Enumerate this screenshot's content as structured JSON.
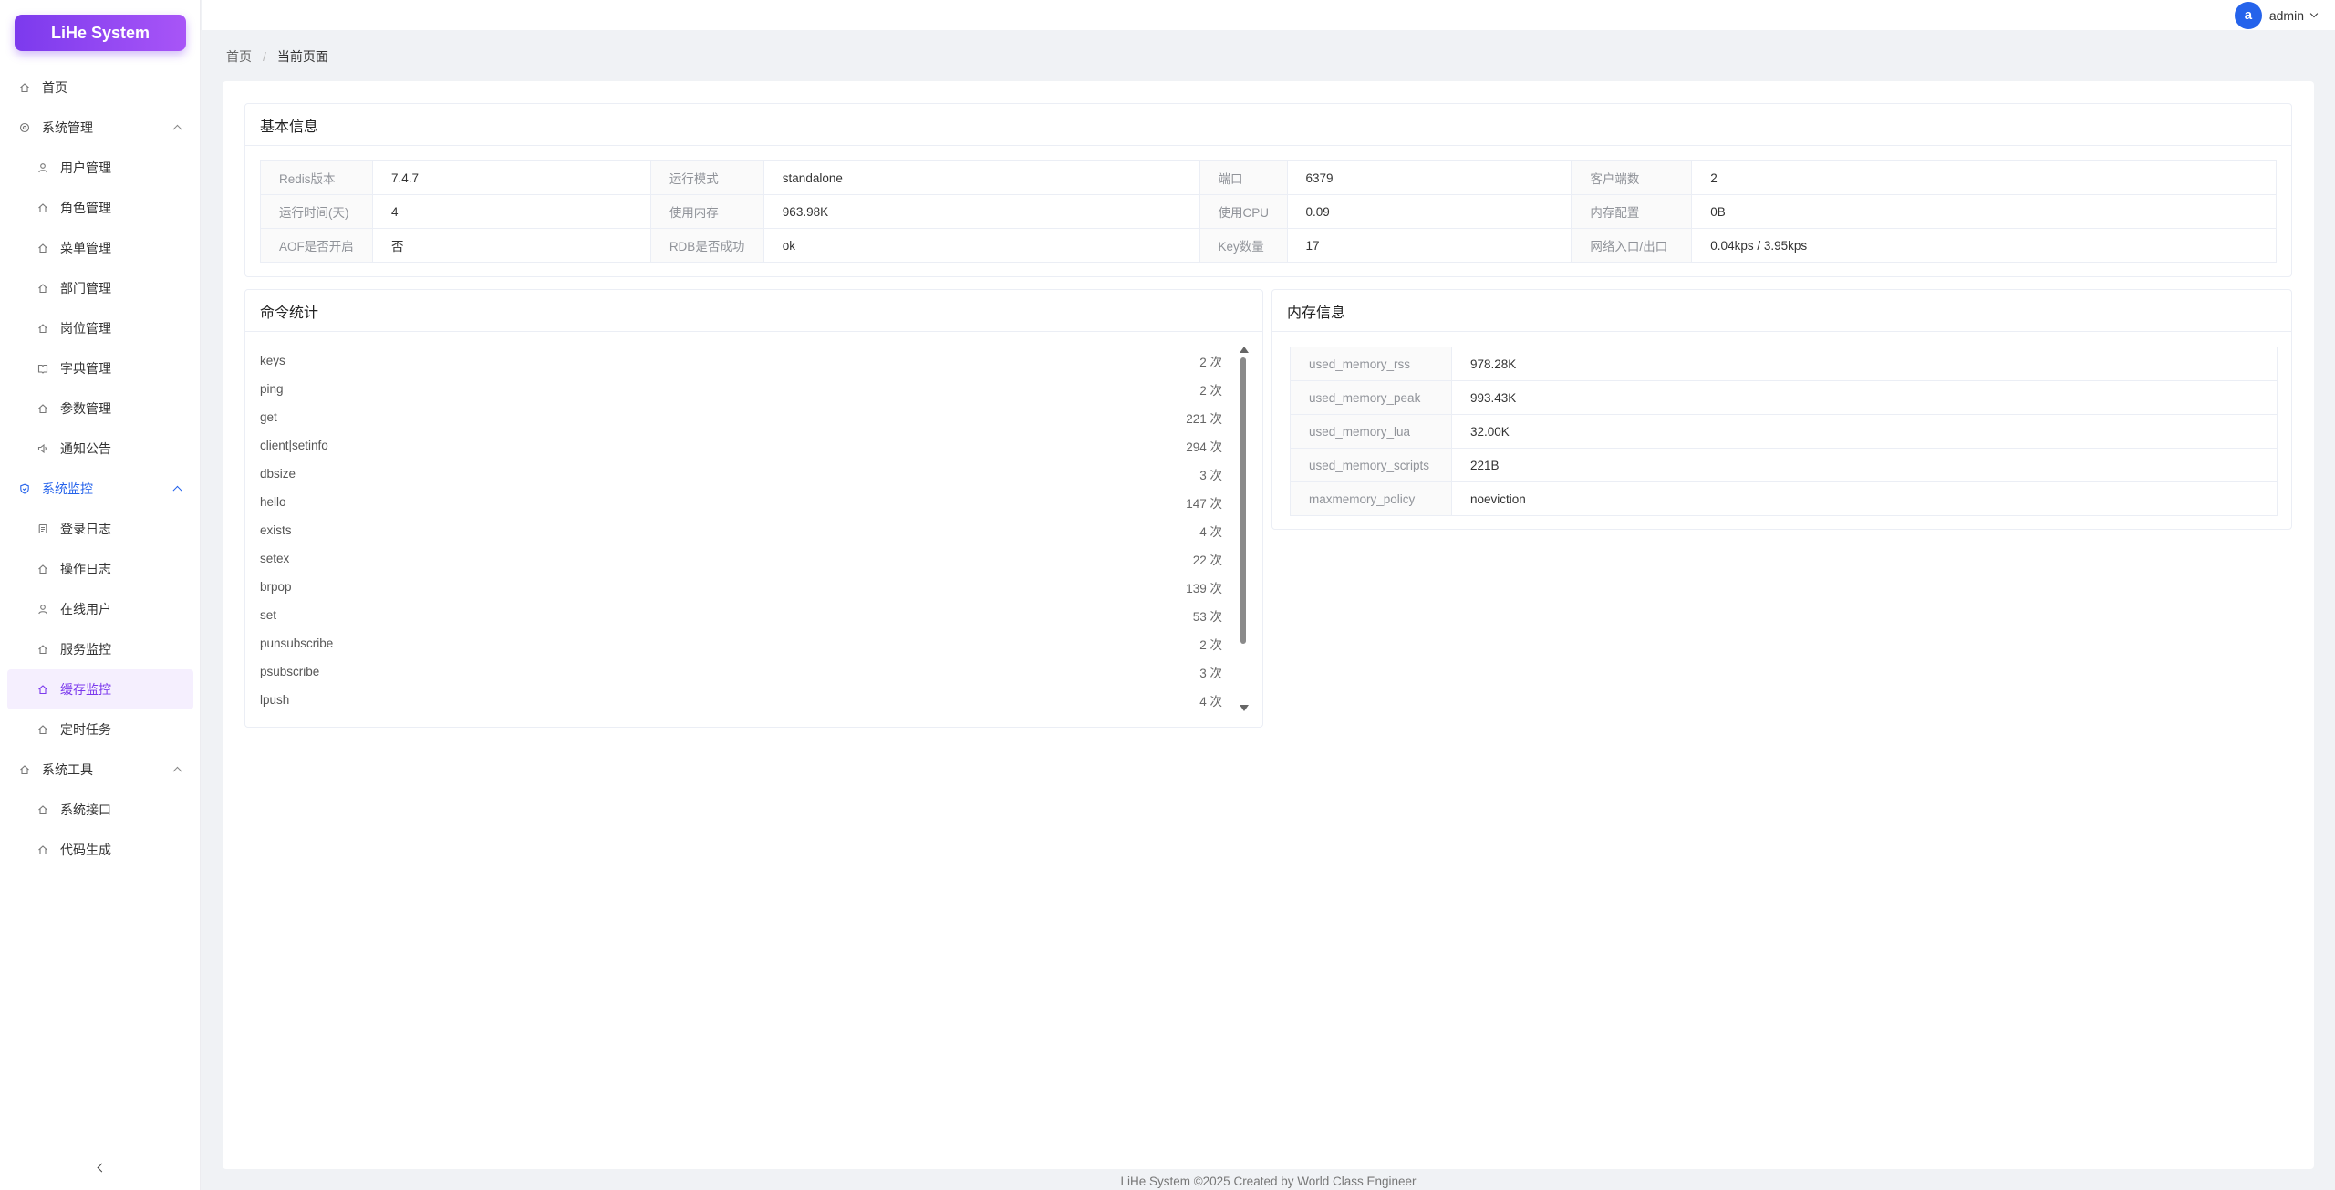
{
  "app": {
    "logo": "LiHe System"
  },
  "sidebar": {
    "items": [
      {
        "label": "首页",
        "icon": "home-icon"
      },
      {
        "label": "系统管理",
        "icon": "gear-icon",
        "group": true
      },
      {
        "label": "用户管理",
        "icon": "user-icon"
      },
      {
        "label": "角色管理",
        "icon": "home-icon"
      },
      {
        "label": "菜单管理",
        "icon": "home-icon"
      },
      {
        "label": "部门管理",
        "icon": "home-icon"
      },
      {
        "label": "岗位管理",
        "icon": "home-icon"
      },
      {
        "label": "字典管理",
        "icon": "book-icon"
      },
      {
        "label": "参数管理",
        "icon": "home-icon"
      },
      {
        "label": "通知公告",
        "icon": "speaker-icon"
      },
      {
        "label": "系统监控",
        "icon": "shield-icon",
        "group": true
      },
      {
        "label": "登录日志",
        "icon": "document-icon"
      },
      {
        "label": "操作日志",
        "icon": "home-icon"
      },
      {
        "label": "在线用户",
        "icon": "user-icon"
      },
      {
        "label": "服务监控",
        "icon": "home-icon"
      },
      {
        "label": "缓存监控",
        "icon": "home-icon"
      },
      {
        "label": "定时任务",
        "icon": "home-icon"
      },
      {
        "label": "系统工具",
        "icon": "home-icon",
        "group": true
      },
      {
        "label": "系统接口",
        "icon": "home-icon"
      },
      {
        "label": "代码生成",
        "icon": "home-icon"
      }
    ]
  },
  "header": {
    "avatar_letter": "a",
    "username": "admin"
  },
  "breadcrumb": {
    "home": "首页",
    "sep": "/",
    "current": "当前页面"
  },
  "basic_info": {
    "title": "基本信息",
    "rows": [
      [
        "Redis版本",
        "7.4.7",
        "运行模式",
        "standalone",
        "端口",
        "6379",
        "客户端数",
        "2"
      ],
      [
        "运行时间(天)",
        "4",
        "使用内存",
        "963.98K",
        "使用CPU",
        "0.09",
        "内存配置",
        "0B"
      ],
      [
        "AOF是否开启",
        "否",
        "RDB是否成功",
        "ok",
        "Key数量",
        "17",
        "网络入口/出口",
        "0.04kps / 3.95kps"
      ]
    ]
  },
  "command_stats": {
    "title": "命令统计",
    "rows": [
      {
        "name": "keys",
        "count": "2 次"
      },
      {
        "name": "ping",
        "count": "2 次"
      },
      {
        "name": "get",
        "count": "221 次"
      },
      {
        "name": "client|setinfo",
        "count": "294 次"
      },
      {
        "name": "dbsize",
        "count": "3 次"
      },
      {
        "name": "hello",
        "count": "147 次"
      },
      {
        "name": "exists",
        "count": "4 次"
      },
      {
        "name": "setex",
        "count": "22 次"
      },
      {
        "name": "brpop",
        "count": "139 次"
      },
      {
        "name": "set",
        "count": "53 次"
      },
      {
        "name": "punsubscribe",
        "count": "2 次"
      },
      {
        "name": "psubscribe",
        "count": "3 次"
      },
      {
        "name": "lpush",
        "count": "4 次"
      }
    ]
  },
  "memory_info": {
    "title": "内存信息",
    "rows": [
      [
        "used_memory_rss",
        "978.28K"
      ],
      [
        "used_memory_peak",
        "993.43K"
      ],
      [
        "used_memory_lua",
        "32.00K"
      ],
      [
        "used_memory_scripts",
        "221B"
      ],
      [
        "maxmemory_policy",
        "noeviction"
      ]
    ]
  },
  "footer": {
    "text": "LiHe System ©2025 Created by World Class Engineer"
  },
  "colors": {
    "accent": "#7c3aed",
    "active_group": "#2563eb",
    "selected_bg": "#f5effe"
  }
}
